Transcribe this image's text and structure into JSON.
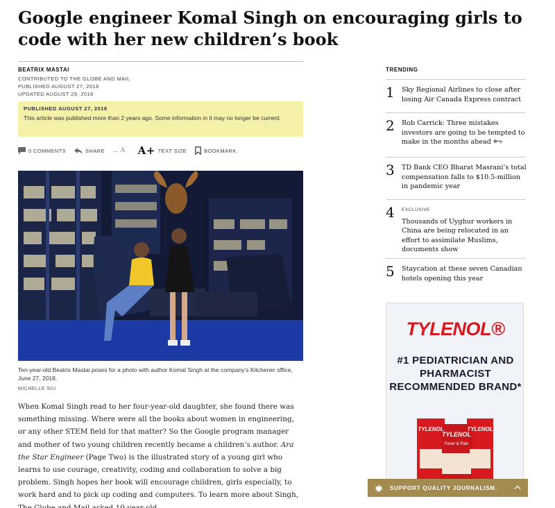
{
  "article": {
    "headline": "Google engineer Komal Singh on encouraging girls to code with her new children’s book",
    "author": "BEATRIX MASTAI",
    "contributed": "CONTRIBUTED TO THE GLOBE AND MAIL",
    "published": "PUBLISHED AUGUST 27, 2018",
    "updated": "UPDATED AUGUST 29, 2018",
    "notice_title": "PUBLISHED AUGUST 27, 2018",
    "notice_body": "This article was published more than 2 years ago. Some information in it may no longer be current.",
    "caption": "Ten-year-old Beatrix Mastai poses for a photo with author Komal Singh at the company’s Kitchener office, June 27, 2018.",
    "photo_credit": "MICHELLE SIU",
    "body_before_italic": "When Komal Singh read to her four-year-old daughter, she found there was something missing. Where were all the books about women in engineering, or any other STEM field for that matter? So the Google program manager and mother of two young children recently became a children’s author. ",
    "body_italic": "Ara the Star Engineer",
    "body_after_italic": " (Page Two) is the illustrated story of a young girl who learns to use courage, creativity, coding and collaboration to solve a big problem. Singh hopes her book will encourage children, girls especially, to work hard and to pick up coding and computers. To learn more about Singh, The Globe and Mail asked 10-year-old"
  },
  "toolbar": {
    "comments": "0 COMMENTS",
    "share": "SHARE",
    "text_small": "A",
    "text_big": "A+",
    "text_size": "TEXT SIZE",
    "bookmark": "BOOKMARK"
  },
  "trending": {
    "title": "TRENDING",
    "items": [
      {
        "num": "1",
        "kicker": "",
        "text": "Sky Regional Airlines to close after losing Air Canada Express contract"
      },
      {
        "num": "2",
        "kicker": "",
        "text": "Rob Carrick: Three mistakes investors are going to be tempted to make in the months ahead"
      },
      {
        "num": "3",
        "kicker": "",
        "text": "TD Bank CEO Bharat Masrani’s total compensation falls to $10.5-million in pandemic year"
      },
      {
        "num": "4",
        "kicker": "EXCLUSIVE",
        "text": "Thousands of Uyghur workers in China are being relocated in an effort to assimilate Muslims, documents show"
      },
      {
        "num": "5",
        "kicker": "",
        "text": "Staycation at these seven Canadian hotels opening this year"
      }
    ]
  },
  "ad": {
    "brand": "TYLENOL®",
    "headline": "#1 PEDIATRICIAN AND PHARMACIST RECOMMENDED BRAND*",
    "box_text_1": "TYLENOL",
    "box_text_2": "Fever & Pain",
    "choice_icon": "ad-choices-icon"
  },
  "support": {
    "label": "SUPPORT QUALITY JOURNALISM."
  },
  "colors": {
    "notice_bg": "#f6f1a8",
    "support_bar": "#a38a4f",
    "tylenol_red": "#d71920"
  }
}
